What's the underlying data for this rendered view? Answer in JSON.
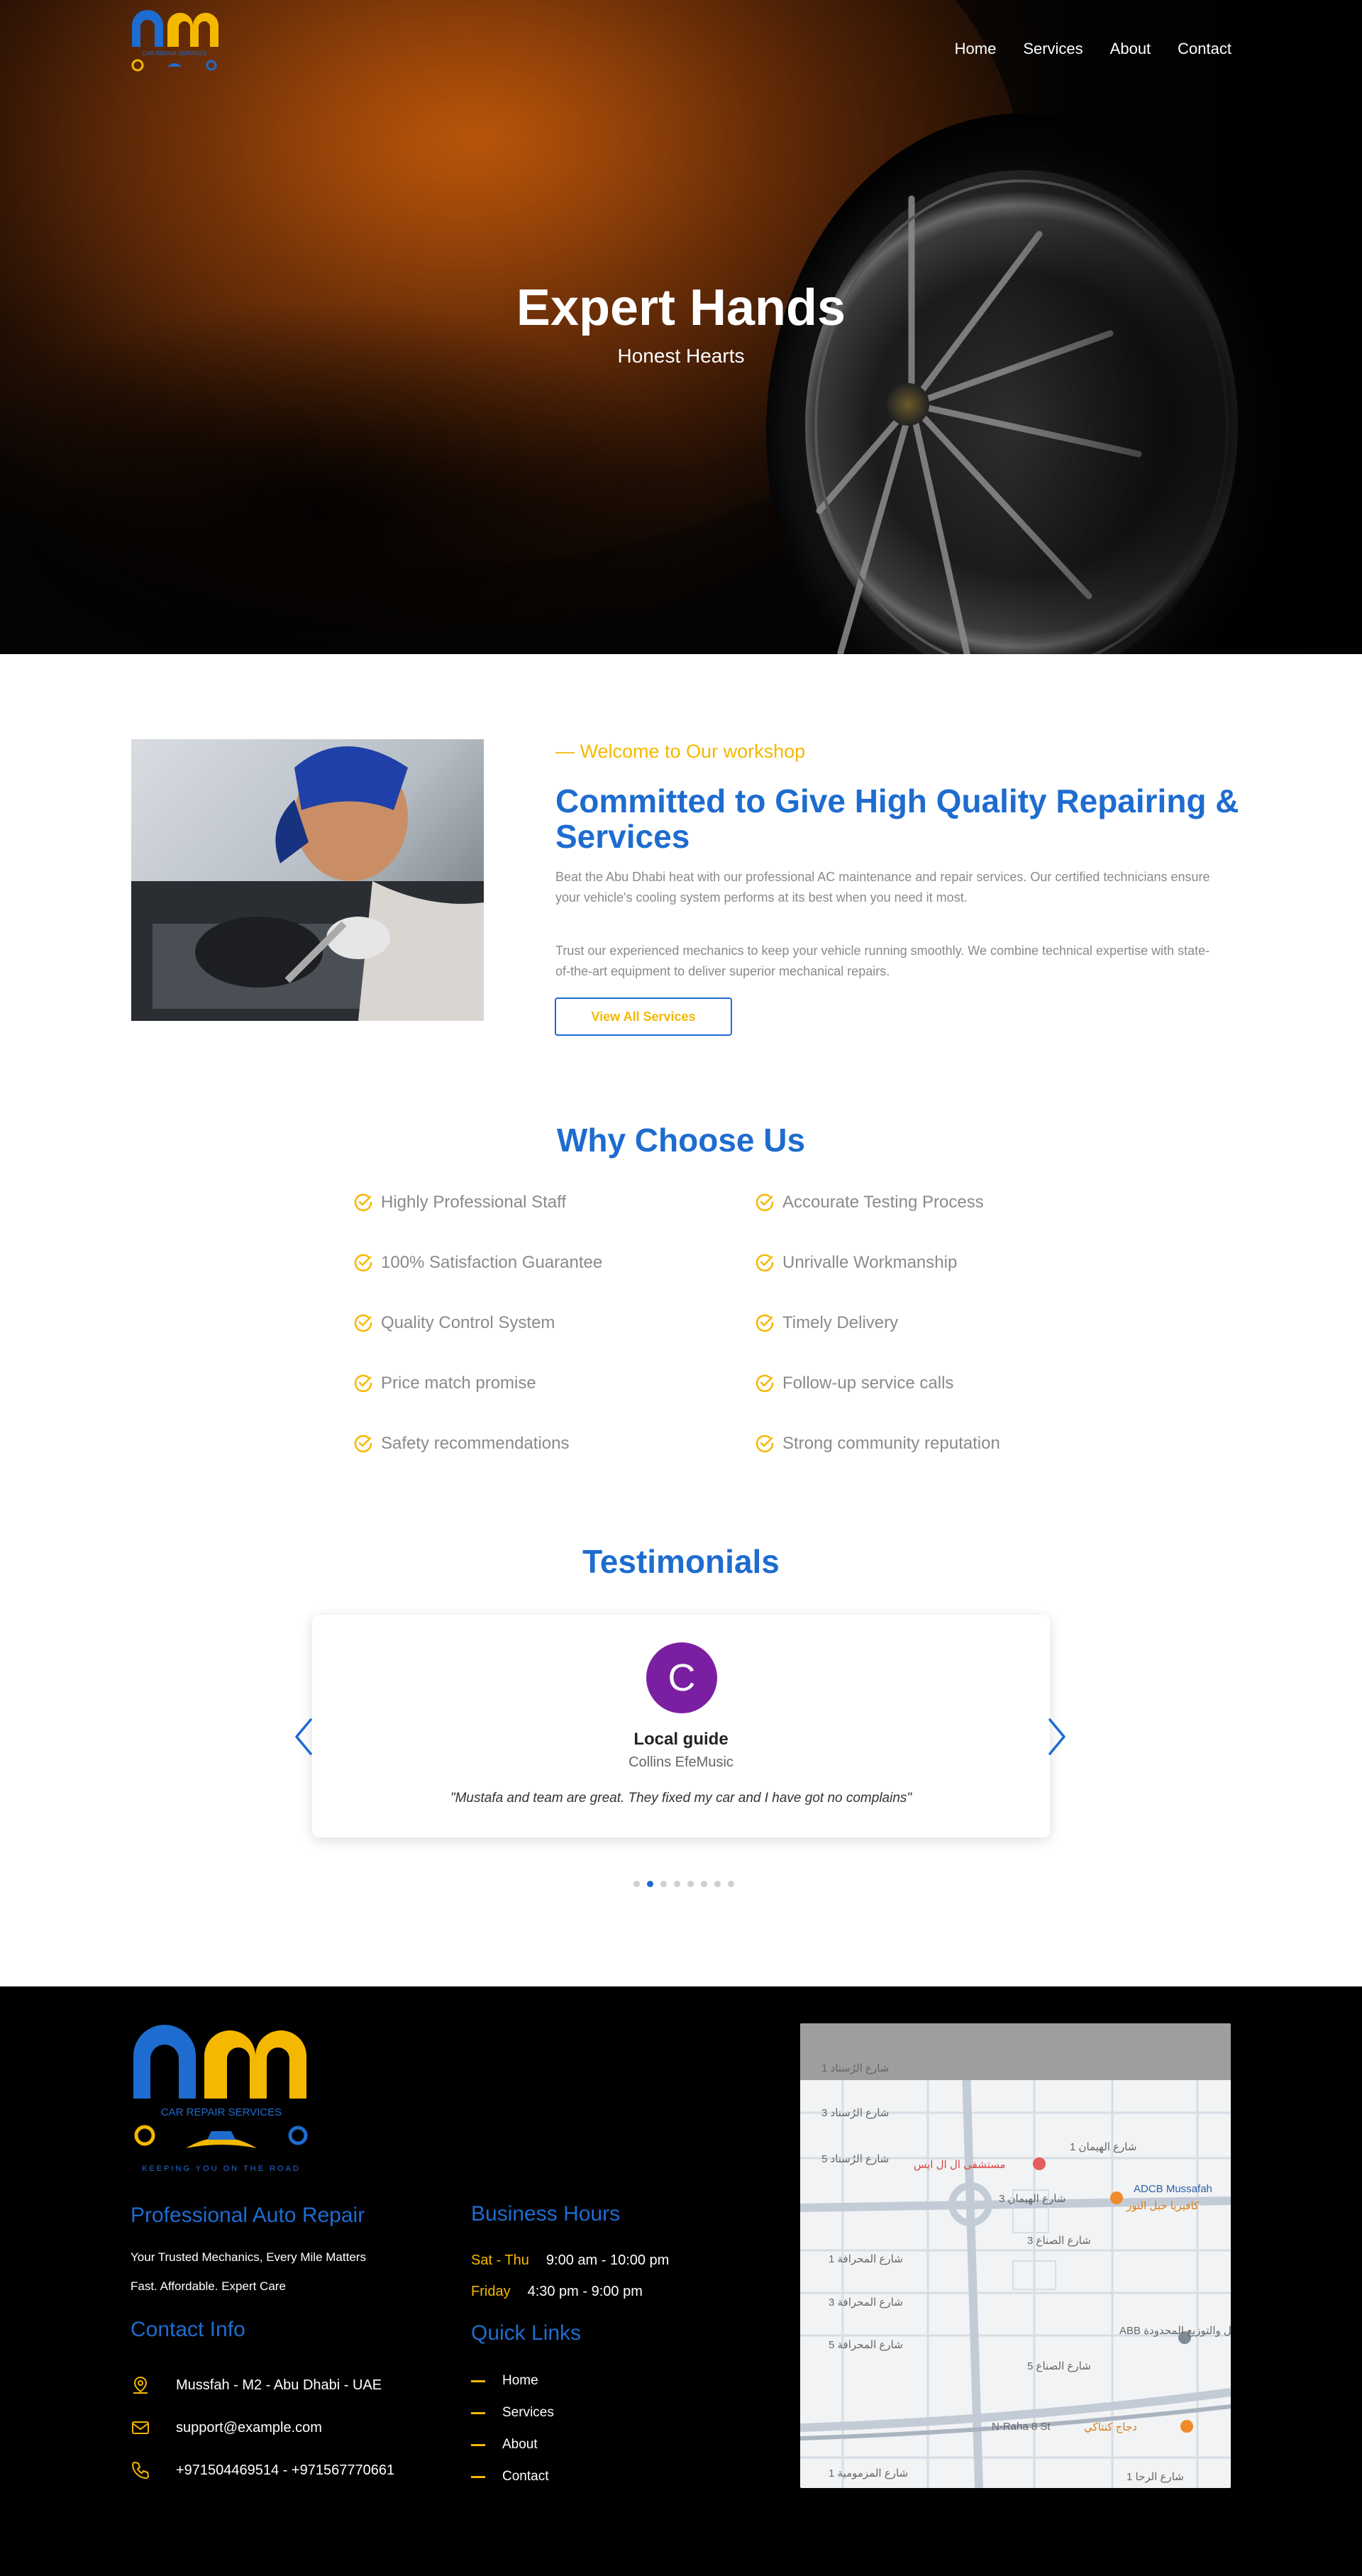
{
  "brand": {
    "logo_letters": "nm",
    "logo_caption": "CAR REPAIR SERVICES",
    "logo_slogan": "KEEPING YOU ON THE ROAD"
  },
  "nav": {
    "items": [
      {
        "label": "Home"
      },
      {
        "label": "Services"
      },
      {
        "label": "About"
      },
      {
        "label": "Contact"
      }
    ]
  },
  "hero": {
    "title": "Expert Hands",
    "subtitle": "Honest Hearts"
  },
  "about": {
    "eyebrow": "— Welcome to Our workshop",
    "title": "Committed to Give High Quality Repairing & Services",
    "paragraph1": "Beat the Abu Dhabi heat with our professional AC maintenance and repair services. Our certified technicians ensure your vehicle's cooling system performs at its best when you need it most.",
    "paragraph2": "Trust our experienced mechanics to keep your vehicle running smoothly. We combine technical expertise with state-of-the-art equipment to deliver superior mechanical repairs.",
    "button_label": "View All Services"
  },
  "why": {
    "title": "Why Choose Us",
    "left": [
      "Highly Professional Staff",
      "100% Satisfaction Guarantee",
      "Quality Control System",
      "Price match promise",
      "Safety recommendations"
    ],
    "right": [
      "Accourate Testing Process",
      "Unrivalle Workmanship",
      "Timely Delivery",
      "Follow-up service calls",
      "Strong community reputation"
    ]
  },
  "testimonials": {
    "title": "Testimonials",
    "avatar_letter": "C",
    "name": "Local guide",
    "author": "Collins EfeMusic",
    "quote": "\"Mustafa and team are great. They fixed my car and I have got no complains\"",
    "slide_count": 8,
    "active_slide": 2
  },
  "footer": {
    "about_heading": "Professional Auto Repair",
    "about_line1": "Your Trusted Mechanics, Every Mile Matters",
    "about_line2": "Fast. Affordable. Expert Care",
    "contact_heading": "Contact Info",
    "address": "Mussfah - M2 - Abu Dhabi - UAE",
    "email": "support@example.com",
    "phone": "+971504469514 - +971567770661",
    "hours_heading": "Business Hours",
    "hours": [
      {
        "days": "Sat - Thu",
        "time": "9:00 am - 10:00 pm"
      },
      {
        "days": "Friday",
        "time": "4:30 pm - 9:00 pm"
      }
    ],
    "links_heading": "Quick Links",
    "links": [
      "Home",
      "Services",
      "About",
      "Contact"
    ]
  },
  "map": {
    "labels": [
      "شارع الرُسناد 1",
      "شارع الرُسناد 3",
      "شارع الرُسناد 5",
      "شارع الهيمان 1",
      "مستشفى ال ال ايس",
      "شارع الهيمان 3",
      "ADCB Mussafah",
      "كافيريا حبل النور",
      "شارع المحرافة 1",
      "شارع الصناع 3",
      "شارع المحرافة 3",
      "ABB الفل والتوزيع المحدودة",
      "شارع المحرافة 5",
      "شارع الصناع 5",
      "N-Raha 8 St",
      "دجاج كنتاكي",
      "شارع المزمومية 1",
      "شارع الرحا 1"
    ]
  },
  "colors": {
    "brand_blue": "#1e6ccf",
    "brand_yellow": "#f5b800",
    "avatar_purple": "#7b1fa2"
  }
}
